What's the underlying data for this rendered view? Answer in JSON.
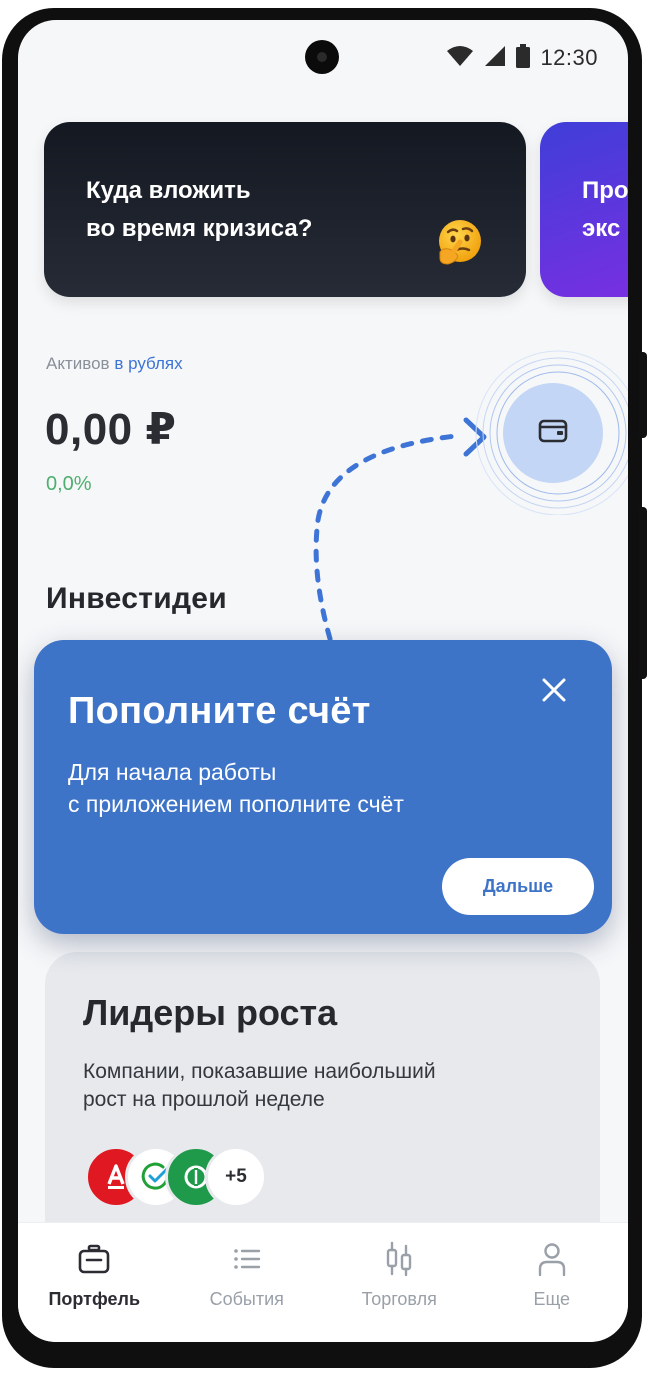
{
  "status_bar": {
    "time": "12:30"
  },
  "promos": [
    {
      "title": "Куда вложить\nво время кризиса?"
    },
    {
      "title": "Про\nэкс"
    }
  ],
  "assets": {
    "label_prefix": "Активов",
    "label_link": "в рублях",
    "balance": "0,00 ₽",
    "change": "0,0%"
  },
  "invest_ideas": {
    "title": "Инвестидеи"
  },
  "popup": {
    "title": "Пополните счёт",
    "text": "Для начала работы\nс приложением пополните счёт",
    "next_label": "Дальше"
  },
  "leaders": {
    "title": "Лидеры роста",
    "description": "Компании, показавшие наибольший\nрост на прошлой неделе",
    "more_label": "+5",
    "company_icons": [
      "alfa-bank-logo",
      "sber-logo",
      "green-company-logo"
    ]
  },
  "nav": {
    "items": [
      {
        "label": "Портфель",
        "icon": "portfolio-icon",
        "active": true
      },
      {
        "label": "События",
        "icon": "list-icon",
        "active": false
      },
      {
        "label": "Торговля",
        "icon": "candles-icon",
        "active": false
      },
      {
        "label": "Еще",
        "icon": "profile-icon",
        "active": false
      }
    ]
  },
  "colors": {
    "accent": "#3d74c8",
    "positive": "#4fae6e",
    "link": "#3d74d6"
  }
}
